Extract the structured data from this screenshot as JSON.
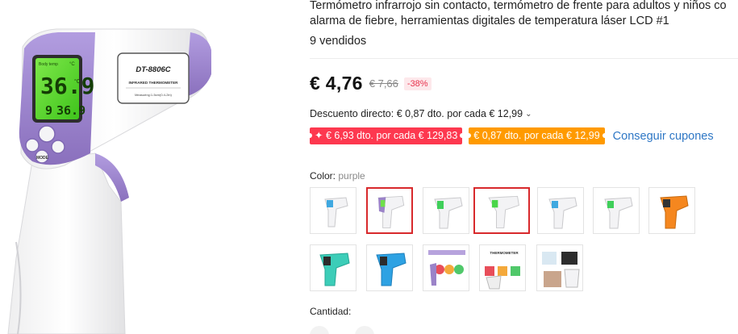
{
  "product": {
    "title_line1": "Termómetro infrarrojo sin contacto, termómetro de frente para adultos y niños co",
    "title_line2": "alarma de fiebre, herramientas digitales de temperatura láser LCD #1",
    "sold": "9 vendidos",
    "price": "€ 4,76",
    "old_price": "€ 7,66",
    "discount_pct": "-38%",
    "direct_discount": "Descuento directo: € 0,87 dto. por cada € 12,99",
    "coupons": [
      "✦ € 6,93 dto. por cada € 129,83",
      "€ 0,87 dto. por cada € 12,99"
    ],
    "get_coupons_label": "Conseguir cupones",
    "color_label": "Color:",
    "color_value": "purple",
    "quantity_label": "Cantidad:"
  },
  "hero_image": {
    "model": "DT-8806C",
    "subtitle": "INFRARED THERMOMETER",
    "measuring": "Measuring:1-5cm(0.4-2in)",
    "lcd_top_left": "Body temp",
    "lcd_top_right": "°C",
    "lcd_main": "36.9",
    "lcd_bottom_left": "9",
    "lcd_bottom_right": "36.9",
    "lcd_unit": "°C",
    "mode_label": "MODE"
  },
  "swatch_text": {
    "infographic_title": "THERMOMETER"
  },
  "colors": {
    "accent_red": "#d8292c",
    "coupon_red": "#fd384f",
    "coupon_orange": "#ff9a00",
    "link_blue": "#2e77c5",
    "purple_body": "#9b83c8"
  }
}
